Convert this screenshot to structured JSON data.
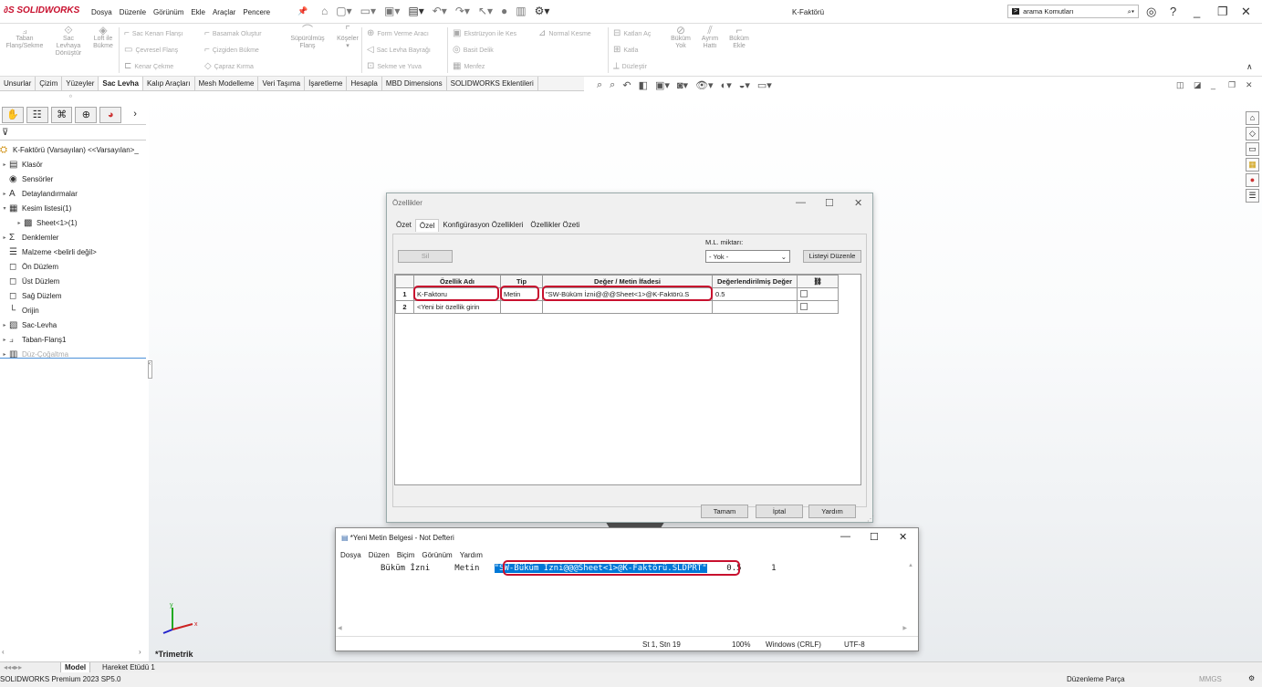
{
  "app": {
    "logo": "SOLIDWORKS",
    "menu": [
      "Dosya",
      "Düzenle",
      "Görünüm",
      "Ekle",
      "Araçlar",
      "Pencere"
    ],
    "title": "K-Faktörü",
    "search_placeholder": "arama Komutları"
  },
  "ribbon": {
    "big": [
      {
        "label": "Taban\nFlanş/Sekme",
        "icon": "flange-icon"
      },
      {
        "label": "Sac\nLevhaya\nDönüştür",
        "icon": "convert-icon"
      },
      {
        "label": "Loft ile\nBükme",
        "icon": "loft-icon"
      }
    ],
    "rows1": [
      "Sac Kenarı Flanşı",
      "Çevresel Flanş",
      "Kenar Çekme"
    ],
    "rows2": [
      "Basamak Oluştur",
      "Çizgiden Bükme",
      "Çapraz Kırma"
    ],
    "big2": [
      {
        "label": "Süpürülmüş\nFlanş"
      },
      {
        "label": "Köşeler"
      }
    ],
    "rows3": [
      "Form Verme Aracı",
      "Sac Levha Bayrağı",
      "Sekme ve Yuva"
    ],
    "rows4": [
      "Ekstrüzyon ile Kes",
      "Basit Delik",
      "Menfez"
    ],
    "rows5": [
      "Normal Kesme"
    ],
    "rows6": [
      "Katları Aç",
      "Katla",
      "Düzleştir"
    ],
    "big3": [
      {
        "label": "Büküm\nYok"
      },
      {
        "label": "Ayrım\nHattı"
      },
      {
        "label": "Büküm\nEkle"
      }
    ]
  },
  "cmd_tabs": [
    "Unsurlar",
    "Çizim",
    "Yüzeyler",
    "Sac Levha",
    "Kalıp Araçları",
    "Mesh Modelleme",
    "Veri Taşıma",
    "İşaretleme",
    "Hesapla",
    "MBD Dimensions",
    "SOLIDWORKS Eklentileri"
  ],
  "active_cmd_tab": "Sac Levha",
  "tree": {
    "root": "K-Faktörü (Varsayılan) <<Varsayılan>_",
    "items": [
      {
        "label": "Klasör",
        "arrow": true,
        "icon": "folder-icon"
      },
      {
        "label": "Sensörler",
        "arrow": false,
        "icon": "sensor-icon"
      },
      {
        "label": "Detaylandırmalar",
        "arrow": true,
        "icon": "annotation-icon"
      },
      {
        "label": "Kesim listesi(1)",
        "arrow": true,
        "icon": "cutlist-icon",
        "open": true
      },
      {
        "label": "Sheet<1>(1)",
        "arrow": true,
        "icon": "sheet-icon",
        "indent": true
      },
      {
        "label": "Denklemler",
        "arrow": true,
        "icon": "equation-icon"
      },
      {
        "label": "Malzeme <belirli değil>",
        "arrow": false,
        "icon": "material-icon"
      },
      {
        "label": "Ön Düzlem",
        "arrow": false,
        "icon": "plane-icon"
      },
      {
        "label": "Üst Düzlem",
        "arrow": false,
        "icon": "plane-icon"
      },
      {
        "label": "Sağ Düzlem",
        "arrow": false,
        "icon": "plane-icon"
      },
      {
        "label": "Orijin",
        "arrow": false,
        "icon": "origin-icon"
      },
      {
        "label": "Sac-Levha",
        "arrow": true,
        "icon": "sheetmetal-icon"
      },
      {
        "label": "Taban-Flanş1",
        "arrow": true,
        "icon": "flange-icon"
      },
      {
        "label": "Düz-Çoğaltma",
        "arrow": true,
        "icon": "flatpattern-icon",
        "dim": true
      }
    ]
  },
  "viewport": {
    "view_label": "*Trimetrik"
  },
  "bottom_tabs": [
    "Model",
    "Hareket Etüdü 1"
  ],
  "status": {
    "left": "SOLIDWORKS Premium 2023 SP5.0",
    "right": "Düzenleme Parça",
    "units": "MMGS"
  },
  "dialog": {
    "title": "Özellikler",
    "tabs": [
      "Özet",
      "Özel",
      "Konfigürasyon Özellikleri",
      "Özellikler Özeti"
    ],
    "active_tab": "Özel",
    "delete_label": "Sil",
    "bom_label": "M.L. miktarı:",
    "bom_value": "- Yok -",
    "edit_list_label": "Listeyi Düzenle",
    "columns": [
      "",
      "Özellik Adı",
      "Tip",
      "Değer / Metin İfadesi",
      "Değerlendirilmiş Değer",
      ""
    ],
    "rows": [
      {
        "num": "1",
        "name": "K-Faktoru",
        "type": "Metin",
        "value": "\"SW-Büküm İzni@@@Sheet<1>@K-Faktörü.S",
        "evaluated": "0.5"
      },
      {
        "num": "2",
        "name": "<Yeni bir özellik girin",
        "type": "",
        "value": "",
        "evaluated": ""
      }
    ],
    "ok": "Tamam",
    "cancel": "İptal",
    "help": "Yardım"
  },
  "notepad": {
    "title": "*Yeni Metin Belgesi - Not Defteri",
    "menu": [
      "Dosya",
      "Düzen",
      "Biçim",
      "Görünüm",
      "Yardım"
    ],
    "line_a": "Büküm İzni     Metin   ",
    "line_sel": "\"SW-Büküm İzni@@@Sheet<1>@K-Faktörü.SLDPRT\"",
    "line_b": "    0.5      1",
    "status": {
      "pos": "St 1, Stn 19",
      "zoom": "100%",
      "eol": "Windows (CRLF)",
      "enc": "UTF-8"
    }
  }
}
